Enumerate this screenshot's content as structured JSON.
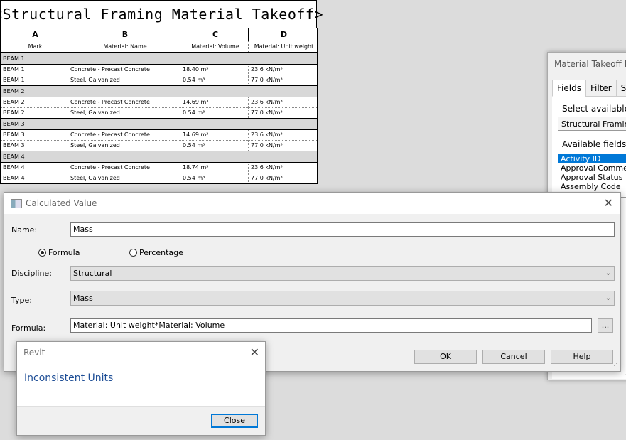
{
  "schedule": {
    "title": "<Structural Framing Material Takeoff>",
    "column_letters": [
      "A",
      "B",
      "C",
      "D"
    ],
    "column_headers": [
      "Mark",
      "Material: Name",
      "Material: Volume",
      "Material: Unit weight"
    ],
    "groups": [
      {
        "name": "BEAM 1",
        "rows": [
          {
            "mark": "BEAM 1",
            "material": "Concrete - Precast Concrete",
            "volume": "18.40 m³",
            "unit_weight": "23.6 kN/m³"
          },
          {
            "mark": "BEAM 1",
            "material": "Steel, Galvanized",
            "volume": "0.54 m³",
            "unit_weight": "77.0 kN/m³"
          }
        ]
      },
      {
        "name": "BEAM 2",
        "rows": [
          {
            "mark": "BEAM 2",
            "material": "Concrete - Precast Concrete",
            "volume": "14.69 m³",
            "unit_weight": "23.6 kN/m³"
          },
          {
            "mark": "BEAM 2",
            "material": "Steel, Galvanized",
            "volume": "0.54 m³",
            "unit_weight": "77.0 kN/m³"
          }
        ]
      },
      {
        "name": "BEAM 3",
        "rows": [
          {
            "mark": "BEAM 3",
            "material": "Concrete - Precast Concrete",
            "volume": "14.69 m³",
            "unit_weight": "23.6 kN/m³"
          },
          {
            "mark": "BEAM 3",
            "material": "Steel, Galvanized",
            "volume": "0.54 m³",
            "unit_weight": "77.0 kN/m³"
          }
        ]
      },
      {
        "name": "BEAM 4",
        "rows": [
          {
            "mark": "BEAM 4",
            "material": "Concrete - Precast Concrete",
            "volume": "18.74 m³",
            "unit_weight": "23.6 kN/m³"
          },
          {
            "mark": "BEAM 4",
            "material": "Steel, Galvanized",
            "volume": "0.54 m³",
            "unit_weight": "77.0 kN/m³"
          }
        ]
      }
    ]
  },
  "mtp": {
    "title": "Material Takeoff Pro",
    "tabs": [
      "Fields",
      "Filter",
      "So"
    ],
    "select_label": "Select available fie",
    "category_value": "Structural Framing",
    "available_label": "Available fields:",
    "fields": [
      "Activity ID",
      "Approval Commen",
      "Approval Status",
      "Assembly Code"
    ]
  },
  "calc": {
    "title": "Calculated Value",
    "name_label": "Name:",
    "name_value": "Mass",
    "formula_radio": "Formula",
    "percentage_radio": "Percentage",
    "discipline_label": "Discipline:",
    "discipline_value": "Structural",
    "type_label": "Type:",
    "type_value": "Mass",
    "formula_label": "Formula:",
    "formula_value": "Material: Unit weight*Material: Volume",
    "browse_label": "...",
    "ok_label": "OK",
    "cancel_label": "Cancel",
    "help_label": "Help"
  },
  "revit": {
    "title": "Revit",
    "message": "Inconsistent Units",
    "close_label": "Close"
  },
  "colors": {
    "accent": "#0078d7",
    "message": "#1e4e96",
    "group_bg": "#d8d8d8"
  }
}
